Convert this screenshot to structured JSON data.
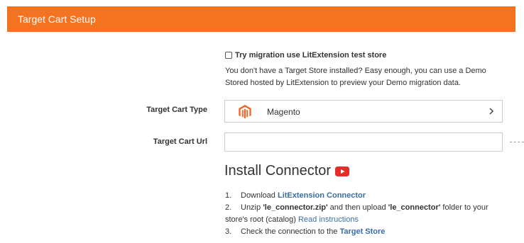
{
  "header": {
    "title": "Target Cart Setup",
    "color": "#f47321"
  },
  "test_store": {
    "checkbox_label": "Try migration use LitExtension test store",
    "checked": false,
    "description": "You don't have a Target Store installed? Easy enough, you can use a Demo Stored hosted by LitExtension to preview your Demo migration data."
  },
  "cart_type": {
    "label": "Target Cart Type",
    "value": "Magento",
    "icon": "magento-icon"
  },
  "cart_url": {
    "label": "Target Cart Url",
    "value": "",
    "placeholder": ""
  },
  "install": {
    "title": "Install Connector",
    "icon": "youtube-icon",
    "steps": [
      {
        "num": "1.",
        "prefix": "Download ",
        "link": "LitExtension Connector"
      },
      {
        "num": "2.",
        "text_a": "Unzip ",
        "file_a": "'le_connector.zip'",
        "text_b": " and then upload ",
        "file_b": "'le_connector'",
        "text_c": " folder to your",
        "line2_text": "store's root (catalog) ",
        "link": "Read instructions"
      },
      {
        "num": "3.",
        "prefix": "Check the connection to the ",
        "link": "Target Store"
      }
    ]
  },
  "colors": {
    "accent": "#f47321",
    "link": "#3a6ea5",
    "youtube": "#e52d27"
  }
}
